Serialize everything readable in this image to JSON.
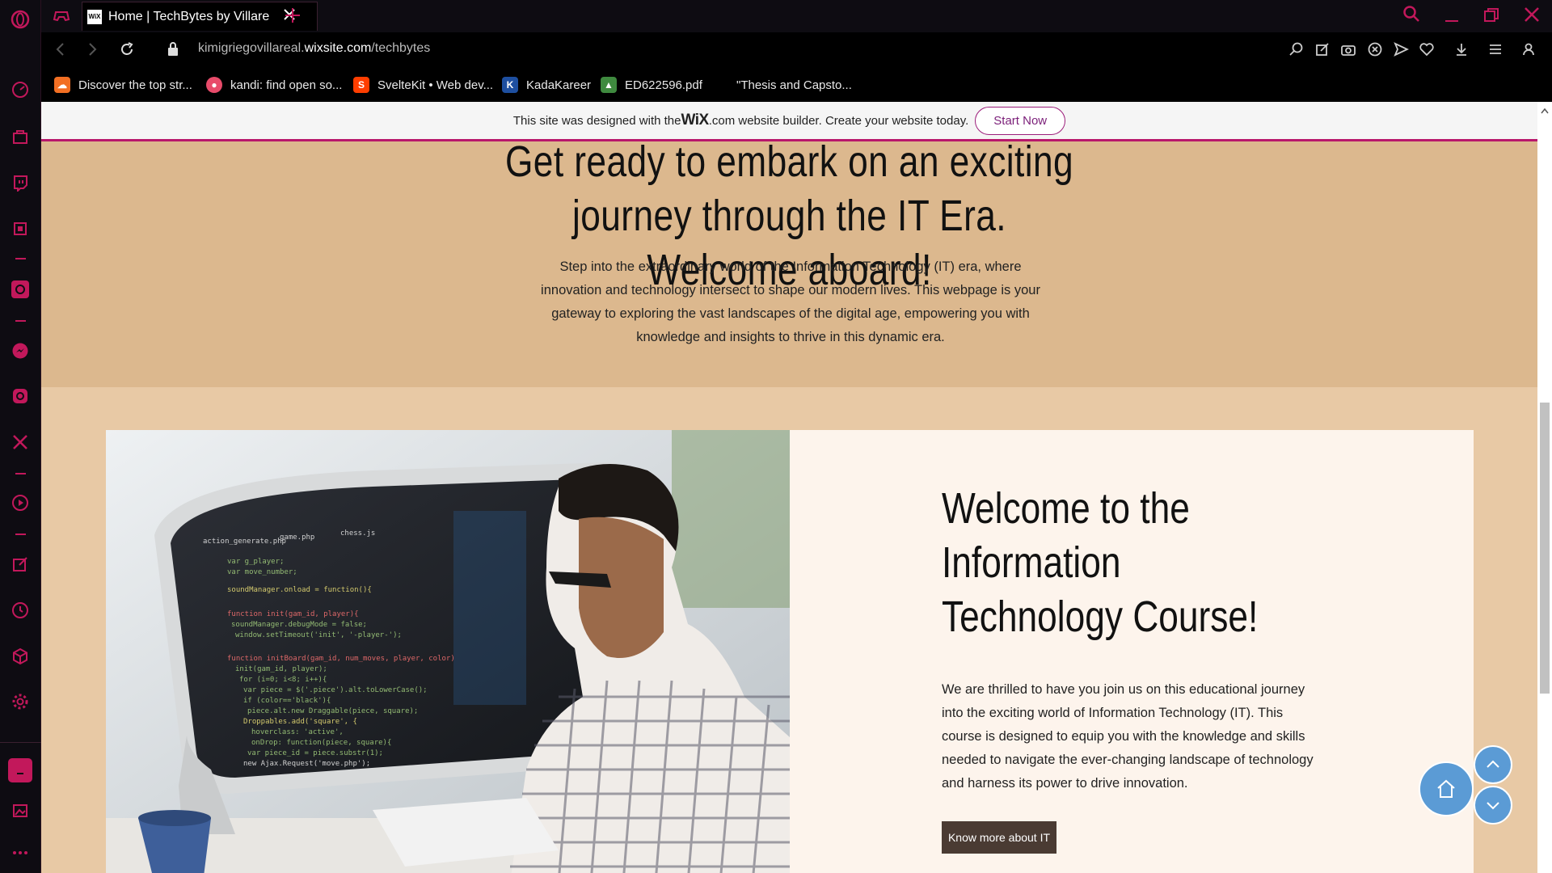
{
  "browser": {
    "tab_title": "Home | TechBytes by Villare",
    "url_host_prefix": "kimigriegovillareal.",
    "url_host_domain": "wixsite.com",
    "url_path": "/techbytes",
    "bookmarks": [
      {
        "label": "Discover the top str...",
        "icon": "soundcloud-icon",
        "color": "#f26f23"
      },
      {
        "label": "kandi: find open so...",
        "icon": "kandi-icon",
        "color": "#e84b6a"
      },
      {
        "label": "SvelteKit • Web dev...",
        "icon": "svelte-icon",
        "color": "#ff3e00"
      },
      {
        "label": "KadaKareer",
        "icon": "kadakareer-icon",
        "color": "#1e4fa0"
      },
      {
        "label": "ED622596.pdf",
        "icon": "pdf-icon",
        "color": "#3f8a3f"
      },
      {
        "label": "\"Thesis and Capsto...",
        "icon": "",
        "color": ""
      }
    ]
  },
  "wix_banner": {
    "text_before": "This site was designed with the ",
    "brand": "WiX",
    "text_after": ".com website builder. Create your website today.",
    "button": "Start Now"
  },
  "hero": {
    "heading": "Get ready to embark on an exciting journey through the IT Era. Welcome aboard!",
    "body": "Step into the extraordinary world of the Information Technology (IT) era, where innovation and technology intersect to shape our modern lives. This webpage is your gateway to exploring the vast landscapes of the digital age, empowering you with knowledge and insights to thrive in this dynamic era."
  },
  "course": {
    "heading": "Welcome to the Information Technology Course!",
    "body": "We are thrilled to have you join us on this educational journey into the exciting world of Information Technology (IT). This course is designed to equip you with the knowledge and skills needed to navigate the ever-changing landscape of technology and harness its power to drive innovation.",
    "button": "Know more about IT",
    "image_alt": "Developer coding at a computer"
  },
  "colors": {
    "accent": "#c2185b",
    "hero_bg": "#dcb88e",
    "section_bg": "#e8c9a5",
    "card_bg": "#fdf4ec",
    "fab": "#5b9bd5"
  }
}
